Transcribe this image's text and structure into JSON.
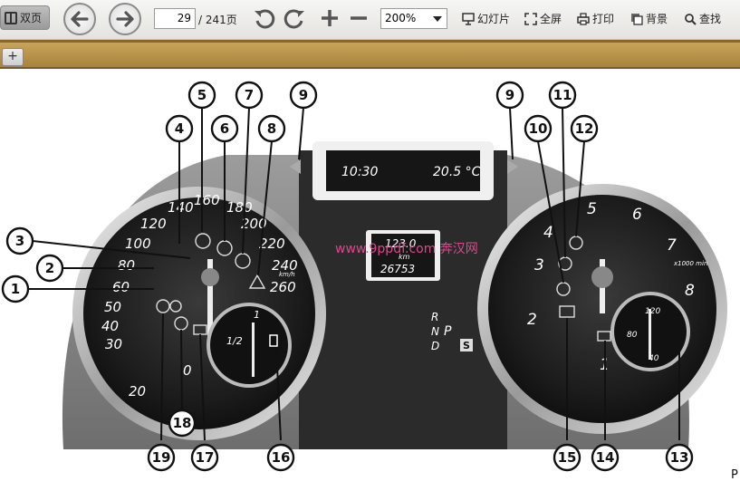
{
  "toolbar": {
    "double_page_label": "双页",
    "page_current": "29",
    "page_total": "/ 241页",
    "zoom": "200%",
    "slideshow_label": "幻灯片",
    "fullscreen_label": "全屏",
    "print_label": "打印",
    "background_label": "背景",
    "find_label": "查找"
  },
  "tabs": {
    "add_label": "+"
  },
  "figure": {
    "center_display": {
      "time": "10:30",
      "temp": "20.5 °C",
      "trip": "123.0",
      "unit": "km",
      "odo": "26753"
    },
    "speed_labels": [
      "20",
      "0",
      "30",
      "40",
      "50",
      "60",
      "80",
      "100",
      "120",
      "140",
      "160",
      "180",
      "200",
      "220",
      "240",
      "260"
    ],
    "speed_unit": "km/h",
    "fuel_labels": [
      "1",
      "1/2"
    ],
    "gear_letters": [
      "R",
      "N",
      "D",
      "P"
    ],
    "gear_mode": "S",
    "rpm_labels": [
      "1",
      "2",
      "3",
      "4",
      "5",
      "6",
      "7",
      "8"
    ],
    "rpm_unit": "x1000 min",
    "temp_labels": [
      "120",
      "80",
      "40"
    ],
    "watermark": "www.9ppdf.com 奔汉网",
    "corner_code": "P",
    "callouts": [
      "1",
      "2",
      "3",
      "4",
      "5",
      "6",
      "7",
      "8",
      "9",
      "9",
      "10",
      "11",
      "12",
      "13",
      "14",
      "15",
      "16",
      "17",
      "18",
      "19"
    ]
  }
}
